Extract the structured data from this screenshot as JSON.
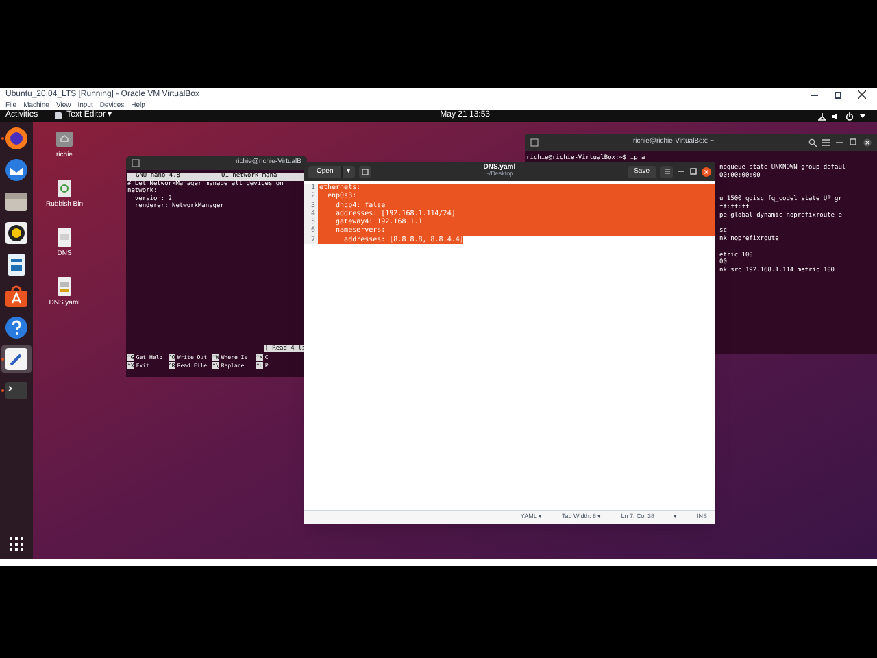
{
  "vbox": {
    "title": "Ubuntu_20.04_LTS [Running] - Oracle VM VirtualBox",
    "menu": [
      "File",
      "Machine",
      "View",
      "Input",
      "Devices",
      "Help"
    ]
  },
  "top_bar": {
    "activities": "Activities",
    "app": "Text Editor",
    "app_caret": "▾",
    "clock": "May 21  13:53"
  },
  "dock_items": [
    {
      "running": true,
      "selected": false
    },
    {
      "running": false,
      "selected": false
    },
    {
      "running": false,
      "selected": false
    },
    {
      "running": false,
      "selected": false
    },
    {
      "running": false,
      "selected": false
    },
    {
      "running": false,
      "selected": false
    },
    {
      "running": false,
      "selected": false
    },
    {
      "running": true,
      "selected": true
    },
    {
      "running": true,
      "selected": false
    }
  ],
  "desktop_icons": [
    {
      "label": "richie"
    },
    {
      "label": "Rubbish Bin"
    },
    {
      "label": "DNS"
    },
    {
      "label": "DNS.yaml"
    }
  ],
  "nano_terminal": {
    "title": "richie@richie-VirtualB",
    "header": [
      "GNU nano 4.8",
      "01-network-mana"
    ],
    "lines": [
      "# Let NetworkManager manage all devices on",
      "network:",
      "  version: 2",
      "  renderer: NetworkManager"
    ],
    "status": "[ Read 4 li",
    "shortcuts": [
      [
        "^G",
        "Get Help"
      ],
      [
        "^O",
        "Write Out"
      ],
      [
        "^W",
        "Where Is"
      ],
      [
        "^K",
        "C"
      ],
      [
        "^X",
        "Exit"
      ],
      [
        "^R",
        "Read File"
      ],
      [
        "^\\",
        "Replace"
      ],
      [
        "^U",
        "P"
      ]
    ]
  },
  "right_terminal": {
    "title": "richie@richie-VirtualBox: ~",
    "prompt": "richie@richie-VirtualBox:~$ ip a",
    "blocks": [
      [
        "noqueue state UNKNOWN group defaul",
        "00:00:00:00"
      ],
      [
        "u 1500 qdisc fq_codel state UP gr",
        "ff:ff:ff",
        "pe global dynamic noprefixroute e"
      ],
      [
        "sc",
        "nk noprefixroute"
      ],
      [
        "etric 100",
        "00",
        "nk src 192.168.1.114 metric 100"
      ]
    ]
  },
  "gedit": {
    "open": "Open",
    "caret": "▾",
    "title": "DNS.yaml",
    "subtitle": "~/Desktop",
    "save": "Save",
    "lines": [
      {
        "number": "1",
        "text": "ethernets:",
        "selected": true
      },
      {
        "number": "2",
        "text": "  enp0s3:",
        "selected": true
      },
      {
        "number": "3",
        "text": "    dhcp4: false",
        "selected": true
      },
      {
        "number": "4",
        "text": "    addresses: [192.168.1.114/24]",
        "selected": true
      },
      {
        "number": "5",
        "text": "    gateway4: 192.168.1.1",
        "selected": true
      },
      {
        "number": "6",
        "text": "    nameservers:",
        "selected": true
      },
      {
        "number": "7",
        "text": "      addresses: [8.8.8.8, 8.8.4.4]",
        "selected": true
      }
    ],
    "status": {
      "language": "YAML ▾",
      "tab_width": "Tab Width: 8 ▾",
      "position": "Ln 7, Col 38",
      "caret": "▾",
      "mode": "INS"
    }
  }
}
